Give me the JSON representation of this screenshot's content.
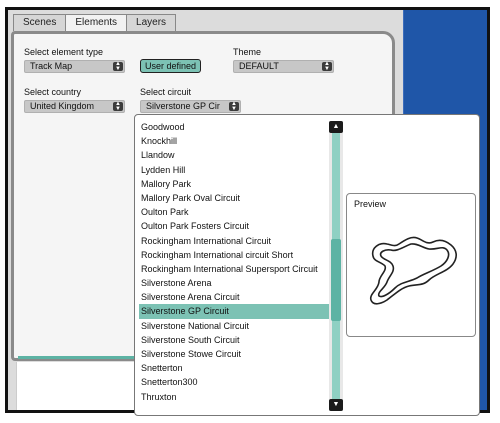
{
  "tabs": [
    "Scenes",
    "Elements",
    "Layers"
  ],
  "active_tab": "Elements",
  "fields": {
    "element_type_label": "Select element type",
    "element_type_value": "Track Map",
    "user_defined_button": "User defined",
    "theme_label": "Theme",
    "theme_value": "DEFAULT",
    "country_label": "Select country",
    "country_value": "United Kingdom",
    "circuit_label": "Select circuit",
    "circuit_value": "Silverstone GP Cir"
  },
  "circuits": [
    "Goodwood",
    "Knockhill",
    "Llandow",
    "Lydden Hill",
    "Mallory Park",
    "Mallory Park Oval Circuit",
    "Oulton Park",
    "Oulton Park Fosters Circuit",
    "Rockingham International Circuit",
    "Rockingham International circuit Short",
    "Rockingham International Supersport Circuit",
    "Silverstone Arena",
    "Silverstone Arena Circuit",
    "Silverstone GP Circuit",
    "Silverstone National Circuit",
    "Silverstone South Circuit",
    "Silverstone Stowe Circuit",
    "Snetterton",
    "Snetterton300",
    "Thruxton"
  ],
  "selected_circuit": "Silverstone GP Circuit",
  "preview_label": "Preview",
  "colors": {
    "accent": "#7cc2b4",
    "window_bg": "#1f56a8"
  }
}
